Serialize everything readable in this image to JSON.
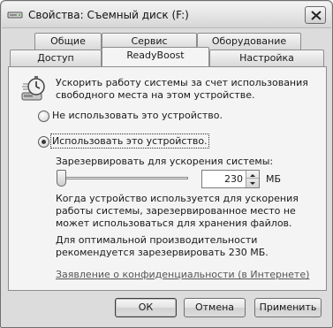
{
  "window": {
    "title": "Свойства: Съемный диск (F:)"
  },
  "tabs_row_top": [
    {
      "label": "Общие"
    },
    {
      "label": "Сервис"
    },
    {
      "label": "Оборудование"
    }
  ],
  "tabs_row_bottom": [
    {
      "label": "Доступ"
    },
    {
      "label": "ReadyBoost",
      "active": true
    },
    {
      "label": "Настройка"
    }
  ],
  "readyboost": {
    "description": "Ускорить работу системы за счет использования свободного места на этом устройстве.",
    "option_off": "Не использовать это устройство.",
    "option_on": "Использовать это устройство.",
    "selected_option": "option_on",
    "reserve_label": "Зарезервировать для ускорения системы:",
    "reserve_value": "230",
    "reserve_unit": "МБ",
    "slider_level_mb": 230,
    "note_usage": "Когда устройство используется для ускорения работы системы, зарезервированное место не может использоваться для хранения файлов.",
    "note_recommend": "Для оптимальной производительности рекомендуется зарезервировать 230 МБ.",
    "privacy_link": "Заявление о конфиденциальности (в Интернете)"
  },
  "buttons": {
    "ok": "ОК",
    "cancel": "Отмена",
    "apply": "Применить"
  }
}
